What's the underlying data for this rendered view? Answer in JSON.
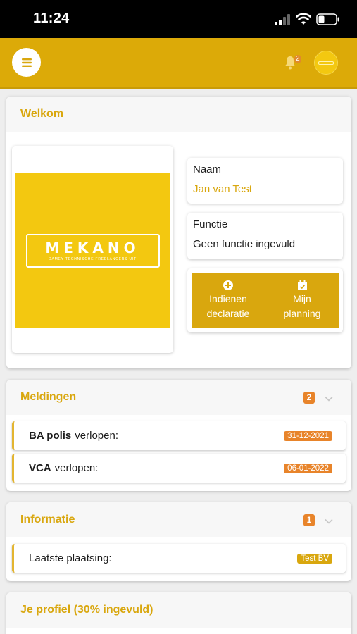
{
  "status_bar": {
    "time": "11:24"
  },
  "app_bar": {
    "notification_count": "2"
  },
  "welcome": {
    "title": "Welkom",
    "logo": {
      "text": "MEKANO",
      "subtitle": "DAMEY TECHNISCHE FREELANCERS UIT"
    },
    "name_label": "Naam",
    "name_value": "Jan van Test",
    "function_label": "Functie",
    "function_value": "Geen functie ingevuld",
    "actions": [
      {
        "line1": "Indienen",
        "line2": "declaratie",
        "icon": "plus-circle-icon"
      },
      {
        "line1": "Mijn",
        "line2": "planning",
        "icon": "calendar-check-icon"
      }
    ]
  },
  "meldingen": {
    "title": "Meldingen",
    "count": "2",
    "items": [
      {
        "bold": "BA polis",
        "text": "verlopen:",
        "date": "31-12-2021"
      },
      {
        "bold": "VCA",
        "text": "verlopen:",
        "date": "06-01-2022"
      }
    ]
  },
  "informatie": {
    "title": "Informatie",
    "count": "1",
    "items": [
      {
        "text": "Laatste plaatsing:",
        "tag": "Test BV"
      }
    ]
  },
  "profiel": {
    "title": "Je profiel (30% ingevuld)"
  },
  "colors": {
    "brand": "#dcaa08",
    "accent_text": "#d9a70e",
    "badge_orange": "#e8842a"
  }
}
